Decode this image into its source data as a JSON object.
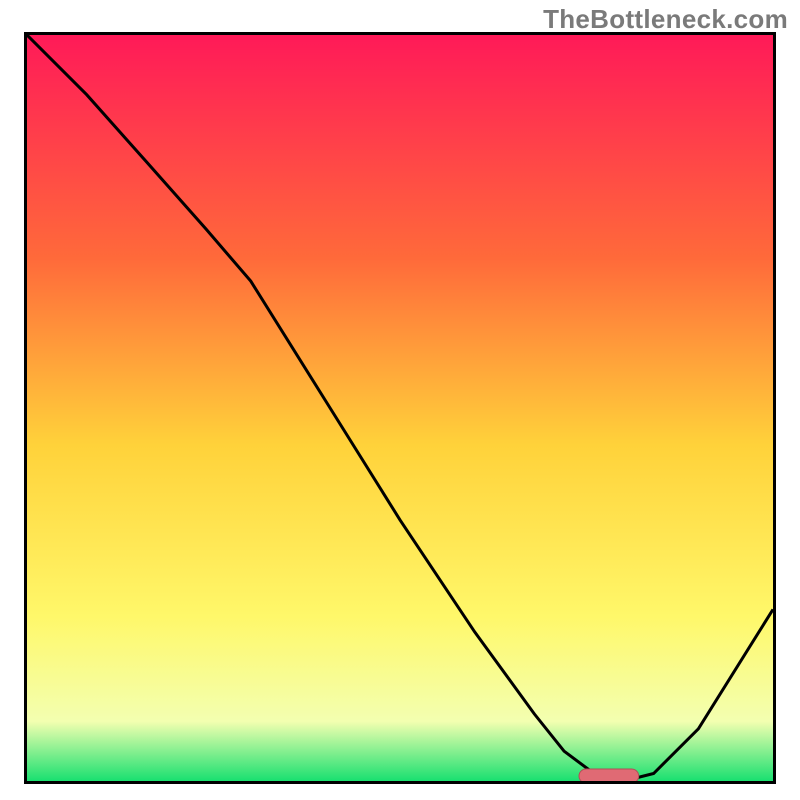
{
  "watermark": "TheBottleneck.com",
  "colors": {
    "border": "#000000",
    "curve": "#000000",
    "marker_fill": "#e06a74",
    "marker_stroke": "#b04e57",
    "grad_top": "#ff1a58",
    "grad_30": "#ff6a3a",
    "grad_55": "#ffd23a",
    "grad_78": "#fff86a",
    "grad_92": "#f3ffb0",
    "grad_bottom": "#19e070"
  },
  "chart_data": {
    "type": "line",
    "title": "",
    "xlabel": "",
    "ylabel": "",
    "xlim": [
      0,
      100
    ],
    "ylim": [
      0,
      100
    ],
    "grid": false,
    "legend": false,
    "series": [
      {
        "name": "bottleneck-curve",
        "x": [
          0,
          8,
          16,
          24,
          30,
          40,
          50,
          60,
          68,
          72,
          76,
          80,
          84,
          90,
          100
        ],
        "y": [
          100,
          92,
          83,
          74,
          67,
          51,
          35,
          20,
          9,
          4,
          1,
          0,
          1,
          7,
          23
        ]
      }
    ],
    "marker": {
      "name": "optimal-point",
      "x_center": 78,
      "x_width": 8,
      "y": 0
    },
    "annotations": []
  }
}
